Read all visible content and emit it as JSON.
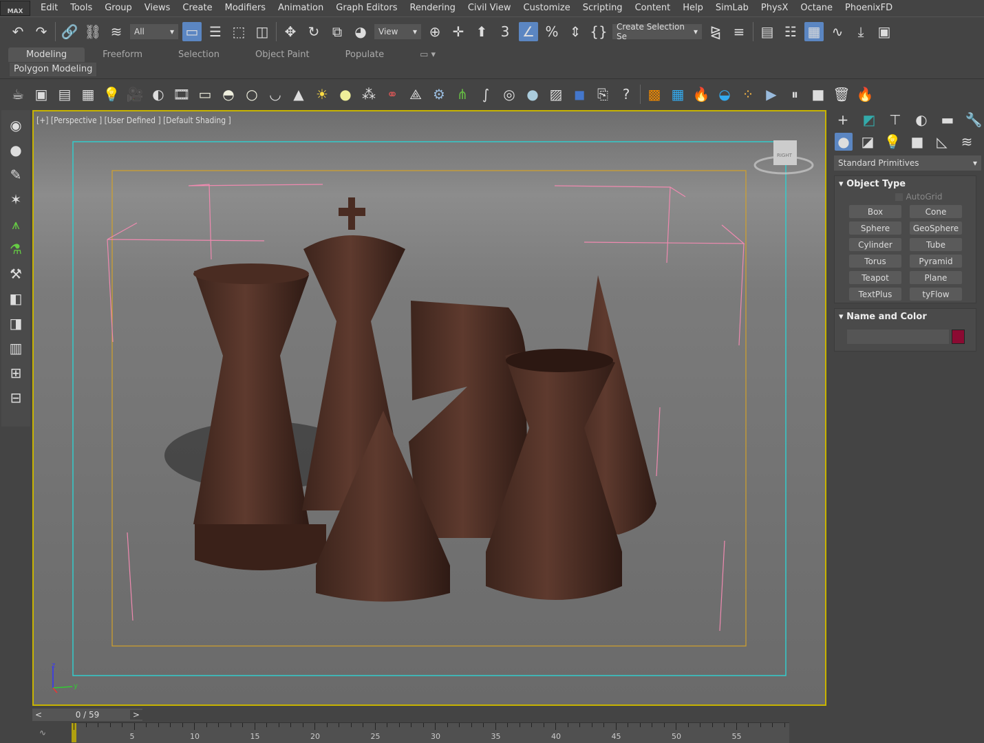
{
  "logo": "MAX",
  "menu": [
    "Edit",
    "Tools",
    "Group",
    "Views",
    "Create",
    "Modifiers",
    "Animation",
    "Graph Editors",
    "Rendering",
    "Civil View",
    "Customize",
    "Scripting",
    "Content",
    "Help",
    "SimLab",
    "PhysX",
    "Octane",
    "PhoenixFD"
  ],
  "toolbar": {
    "filter": "All",
    "ref_coord": "View",
    "selection_set": "Create Selection Se"
  },
  "ribbon": {
    "tabs": [
      "Modeling",
      "Freeform",
      "Selection",
      "Object Paint",
      "Populate"
    ],
    "active": "Modeling",
    "panel": "Polygon Modeling"
  },
  "viewport": {
    "label": "[+] [Perspective ] [User Defined ] [Default Shading ]",
    "viewcube": "RIGHT",
    "axes": {
      "z": "z",
      "y": "y"
    }
  },
  "command_panel": {
    "category": "Standard Primitives",
    "object_type": {
      "title": "Object Type",
      "autogrid": "AutoGrid",
      "buttons": [
        "Box",
        "Cone",
        "Sphere",
        "GeoSphere",
        "Cylinder",
        "Tube",
        "Torus",
        "Pyramid",
        "Teapot",
        "Plane",
        "TextPlus",
        "tyFlow"
      ]
    },
    "name_color": {
      "title": "Name and Color",
      "name": "",
      "color": "#8b0a32"
    }
  },
  "timeline": {
    "frame": "0 / 59",
    "prev": "<",
    "next": ">",
    "ticks": [
      "5",
      "10",
      "15",
      "20",
      "25",
      "30",
      "35",
      "40",
      "45",
      "50",
      "55"
    ],
    "progress": 0
  }
}
